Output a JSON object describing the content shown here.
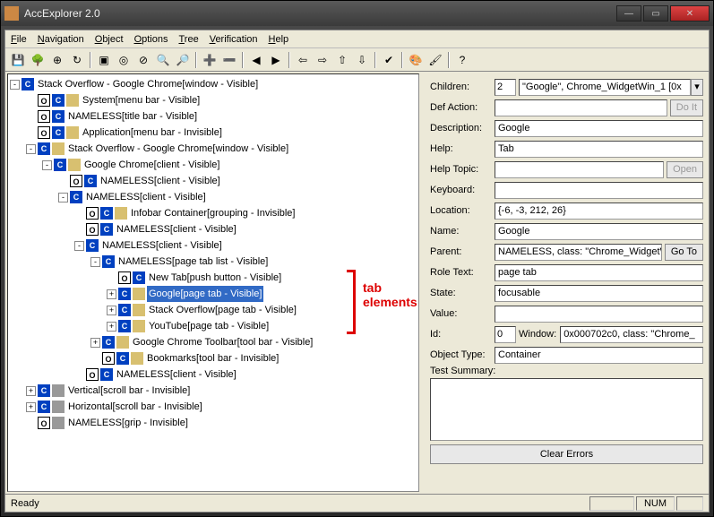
{
  "window": {
    "title": "AccExplorer 2.0"
  },
  "menu": [
    "File",
    "Navigation",
    "Object",
    "Options",
    "Tree",
    "Verification",
    "Help"
  ],
  "toolbar_icons": [
    "save",
    "tree",
    "target",
    "refresh",
    "",
    "rect-in",
    "circle",
    "cancel",
    "find",
    "find-next",
    "",
    "plus",
    "minus",
    "",
    "prev-yellow",
    "next-yellow",
    "",
    "left-blue",
    "right-blue",
    "up-blue",
    "down-blue",
    "",
    "check",
    "",
    "palette",
    "paint",
    "",
    "help"
  ],
  "tree": [
    {
      "d": 0,
      "e": "-",
      "i": [
        "c"
      ],
      "t": "Stack Overflow - Google Chrome[window - Visible]"
    },
    {
      "d": 1,
      "e": " ",
      "i": [
        "o",
        "c",
        "f"
      ],
      "t": "System[menu bar - Visible]"
    },
    {
      "d": 1,
      "e": " ",
      "i": [
        "o",
        "c"
      ],
      "t": "NAMELESS[title bar - Visible]"
    },
    {
      "d": 1,
      "e": " ",
      "i": [
        "o",
        "c",
        "f"
      ],
      "t": "Application[menu bar - Invisible]"
    },
    {
      "d": 1,
      "e": "-",
      "i": [
        "c",
        "f"
      ],
      "t": "Stack Overflow - Google Chrome[window - Visible]"
    },
    {
      "d": 2,
      "e": "-",
      "i": [
        "c",
        "f"
      ],
      "t": "Google Chrome[client - Visible]"
    },
    {
      "d": 3,
      "e": " ",
      "i": [
        "o",
        "c"
      ],
      "t": "NAMELESS[client - Visible]"
    },
    {
      "d": 3,
      "e": "-",
      "i": [
        "c"
      ],
      "t": "NAMELESS[client - Visible]"
    },
    {
      "d": 4,
      "e": " ",
      "i": [
        "o",
        "c",
        "f"
      ],
      "t": "Infobar Container[grouping - Invisible]"
    },
    {
      "d": 4,
      "e": " ",
      "i": [
        "o",
        "c"
      ],
      "t": "NAMELESS[client - Visible]"
    },
    {
      "d": 4,
      "e": "-",
      "i": [
        "c"
      ],
      "t": "NAMELESS[client - Visible]"
    },
    {
      "d": 5,
      "e": "-",
      "i": [
        "c"
      ],
      "t": "NAMELESS[page tab list - Visible]"
    },
    {
      "d": 6,
      "e": " ",
      "i": [
        "o",
        "c"
      ],
      "t": "New Tab[push button - Visible]"
    },
    {
      "d": 6,
      "e": "+",
      "i": [
        "c",
        "f"
      ],
      "t": "Google[page tab - Visible]",
      "sel": true
    },
    {
      "d": 6,
      "e": "+",
      "i": [
        "c",
        "f"
      ],
      "t": "Stack Overflow[page tab - Visible]"
    },
    {
      "d": 6,
      "e": "+",
      "i": [
        "c",
        "f"
      ],
      "t": "YouTube[page tab - Visible]"
    },
    {
      "d": 5,
      "e": "+",
      "i": [
        "c",
        "f"
      ],
      "t": "Google Chrome Toolbar[tool bar - Visible]"
    },
    {
      "d": 5,
      "e": " ",
      "i": [
        "o",
        "c",
        "f"
      ],
      "t": "Bookmarks[tool bar - Invisible]"
    },
    {
      "d": 4,
      "e": " ",
      "i": [
        "o",
        "c"
      ],
      "t": "NAMELESS[client - Visible]"
    },
    {
      "d": 1,
      "e": "+",
      "i": [
        "c",
        "h"
      ],
      "t": "Vertical[scroll bar - Invisible]"
    },
    {
      "d": 1,
      "e": "+",
      "i": [
        "c",
        "h"
      ],
      "t": "Horizontal[scroll bar - Invisible]"
    },
    {
      "d": 1,
      "e": " ",
      "i": [
        "o",
        "h"
      ],
      "t": "NAMELESS[grip - Invisible]"
    }
  ],
  "annotation": {
    "label": "tab\nelements"
  },
  "props": {
    "children_n": "2",
    "children_v": "\"Google\", Chrome_WidgetWin_1 [0x",
    "def_action": "",
    "do_it": "Do It",
    "description": "Google",
    "help": "Tab",
    "help_topic": "",
    "open": "Open",
    "keyboard": "",
    "location": "{-6, -3, 212, 26}",
    "name": "Google",
    "parent": "NAMELESS, class: \"Chrome_WidgetW",
    "goto": "Go To",
    "role_text": "page tab",
    "state": "focusable",
    "value": "",
    "id_n": "0",
    "window_lbl": "Window:",
    "window_v": "0x000702c0, class: \"Chrome_",
    "object_type": "Container",
    "clear": "Clear Errors"
  },
  "labels": {
    "children": "Children:",
    "def_action": "Def Action:",
    "description": "Description:",
    "help": "Help:",
    "help_topic": "Help Topic:",
    "keyboard": "Keyboard:",
    "location": "Location:",
    "name": "Name:",
    "parent": "Parent:",
    "role_text": "Role Text:",
    "state": "State:",
    "value": "Value:",
    "id": "Id:",
    "object_type": "Object Type:",
    "test_summary": "Test Summary:"
  },
  "status": {
    "ready": "Ready",
    "num": "NUM"
  }
}
